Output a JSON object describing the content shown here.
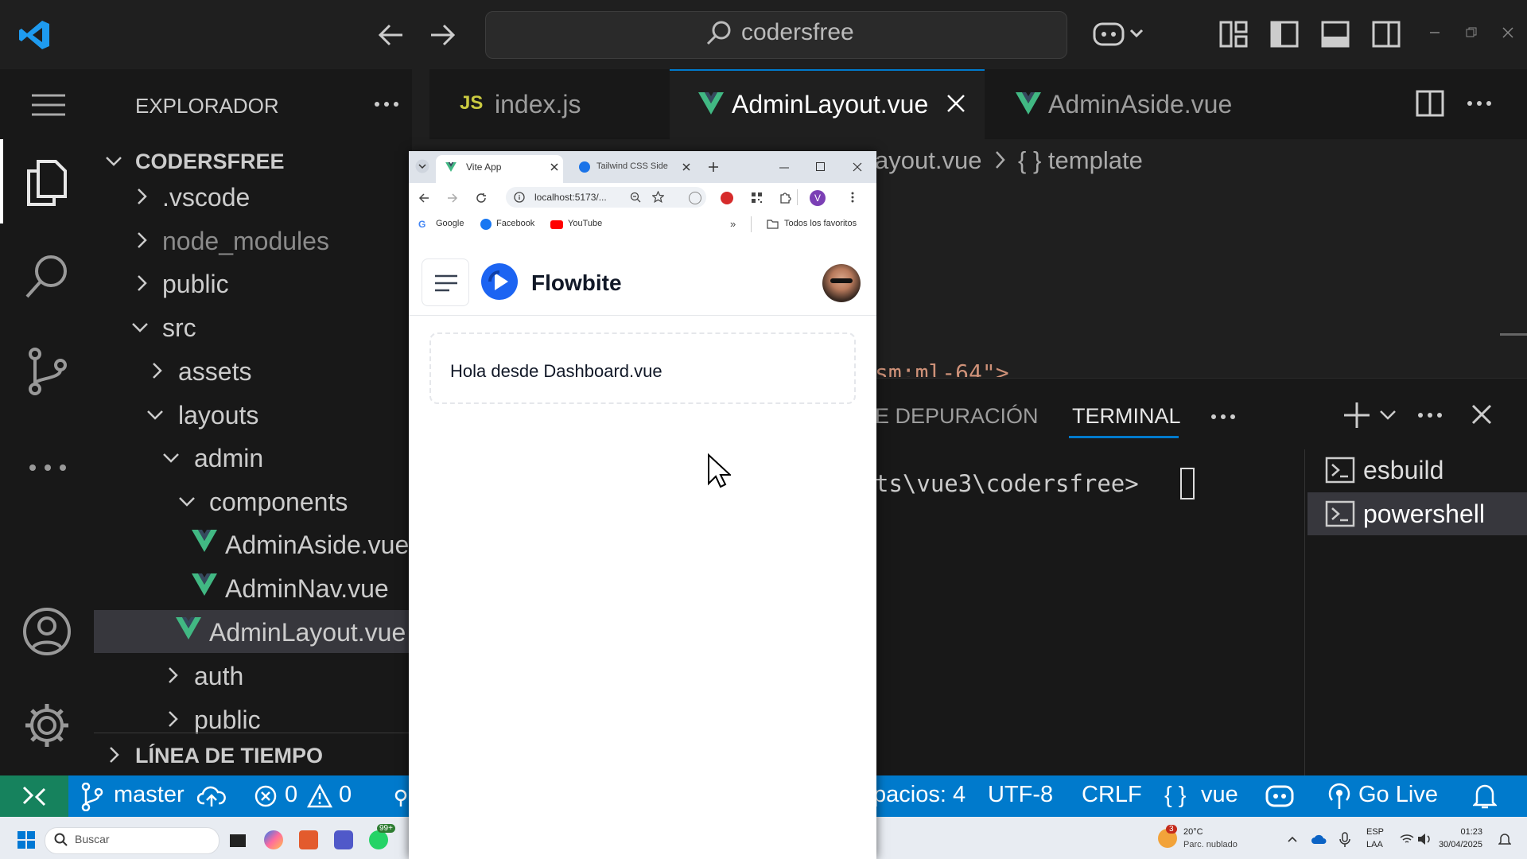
{
  "titlebar": {
    "search_text": "codersfree"
  },
  "sidebar": {
    "header": "EXPLORADOR",
    "project": "CODERSFREE",
    "items": [
      ".vscode",
      "node_modules",
      "public",
      "src",
      "assets",
      "layouts",
      "admin",
      "components",
      "AdminAside.vue",
      "AdminNav.vue",
      "AdminLayout.vue",
      "auth",
      "public"
    ],
    "timeline": "LÍNEA DE TIEMPO"
  },
  "tabs": [
    {
      "label": "index.js",
      "badge": "JS"
    },
    {
      "label": "AdminLayout.vue"
    },
    {
      "label": "AdminAside.vue"
    }
  ],
  "editor": {
    "breadcrumb_file": "ayout.vue",
    "breadcrumb_symbol": "{ } template",
    "code_fragment": "sm:ml-64\">"
  },
  "panel": {
    "tab_debug": "E DEPURACIÓN",
    "tab_terminal": "TERMINAL",
    "prompt": "ts\\vue3\\codersfree>",
    "terminals": [
      "esbuild",
      "powershell"
    ]
  },
  "statusbar": {
    "branch": "master",
    "errors": "0",
    "warnings": "0",
    "spaces": "pacios: 4",
    "encoding": "UTF-8",
    "eol": "CRLF",
    "language": "vue",
    "golive": "Go Live"
  },
  "browser": {
    "tabs": [
      "Vite App",
      "Tailwind CSS Side"
    ],
    "url": "localhost:5173/...",
    "bookmarks": [
      "Google",
      "Facebook",
      "YouTube"
    ],
    "all_favorites": "Todos los favoritos",
    "profile_initial": "V",
    "brand": "Flowbite",
    "content_text": "Hola desde Dashboard.vue"
  },
  "taskbar": {
    "search_placeholder": "Buscar",
    "teams_badge": "99+",
    "weather_badge": "3",
    "temperature": "20°C",
    "weather": "Parc. nublado",
    "lang1": "ESP",
    "lang2": "LAA",
    "time": "01:23",
    "date": "30/04/2025"
  },
  "colors": {
    "vue_green": "#41b883",
    "vscode_blue": "#007acc",
    "js_yellow": "#cbcb41"
  }
}
